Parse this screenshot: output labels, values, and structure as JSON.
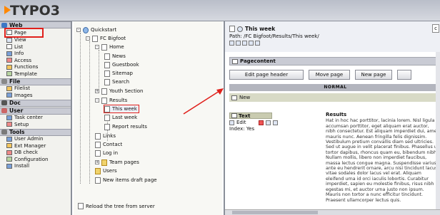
{
  "app": {
    "logo": "TYPO3"
  },
  "module_menu": {
    "groups": [
      {
        "label": "Web",
        "items": [
          "Page",
          "View",
          "List",
          "Info",
          "Access",
          "Functions",
          "Template"
        ]
      },
      {
        "label": "File",
        "items": [
          "Filelist",
          "Images"
        ]
      },
      {
        "label": "Doc",
        "items": []
      },
      {
        "label": "User",
        "items": [
          "Task center",
          "Setup"
        ]
      },
      {
        "label": "Tools",
        "items": [
          "User Admin",
          "Ext Manager",
          "DB check",
          "Configuration",
          "Install"
        ]
      }
    ]
  },
  "tree": {
    "root": "Quickstart",
    "nodes": [
      "FC Bigfoot",
      "Home",
      "News",
      "Guestbook",
      "Sitemap",
      "Search",
      "Youth Section",
      "Results",
      "This week",
      "Last week",
      "Report results",
      "Links",
      "Contact",
      "Log in",
      "Team pages",
      "Users",
      "New items draft page"
    ],
    "footer": "Reload the tree from server"
  },
  "content": {
    "page_title": "This week",
    "path": "Path: /FC Bigfoot/Results/This week/",
    "section": "Pagecontent",
    "buttons": [
      "Edit page header",
      "Move page",
      "New page"
    ],
    "column": "NORMAL",
    "new_label": "New",
    "element_type": "Text",
    "edit_label": "Edit",
    "index_line": "Index: Yes",
    "rt_title": "Results",
    "body": "Hat in hoc hac porttitor, lacinia lorem. Nisl ligula accumsan porttitor, eget aliquam erat auctor, nibh consectetur. Est aliquam imperdiet dui, amet mauris nunc. Aenean fringilla felis dignissim. Vestibulum pretium convallis diam sed ultricies. Sed ut augue in velit placerat finibus. Phasellus ut tortor dapibus, rhoncus quam eu, bibendum nibh. Nullam mollis, libero non imperdiet faucibus, massa lectus congue magna. Suspendisse varius, ante eu hendrerit ornare, arcu nisi tincidunt lacus, vitae sodales dolor lacus vel erat. Aliquam eleifend urna id orci iaculis lobortis. Curabitur imperdiet, sapien eu molestie finibus, risus nibh egestas mi, et auctor urna justo non ipsum. Mauris non tortor a nunc efficitur tincidunt. Praesent ullamcorper lectus quis."
  },
  "colors": {
    "highlight": "#e0201b",
    "frame": "#8a8f99",
    "header_bg": "#c9cbd4"
  }
}
